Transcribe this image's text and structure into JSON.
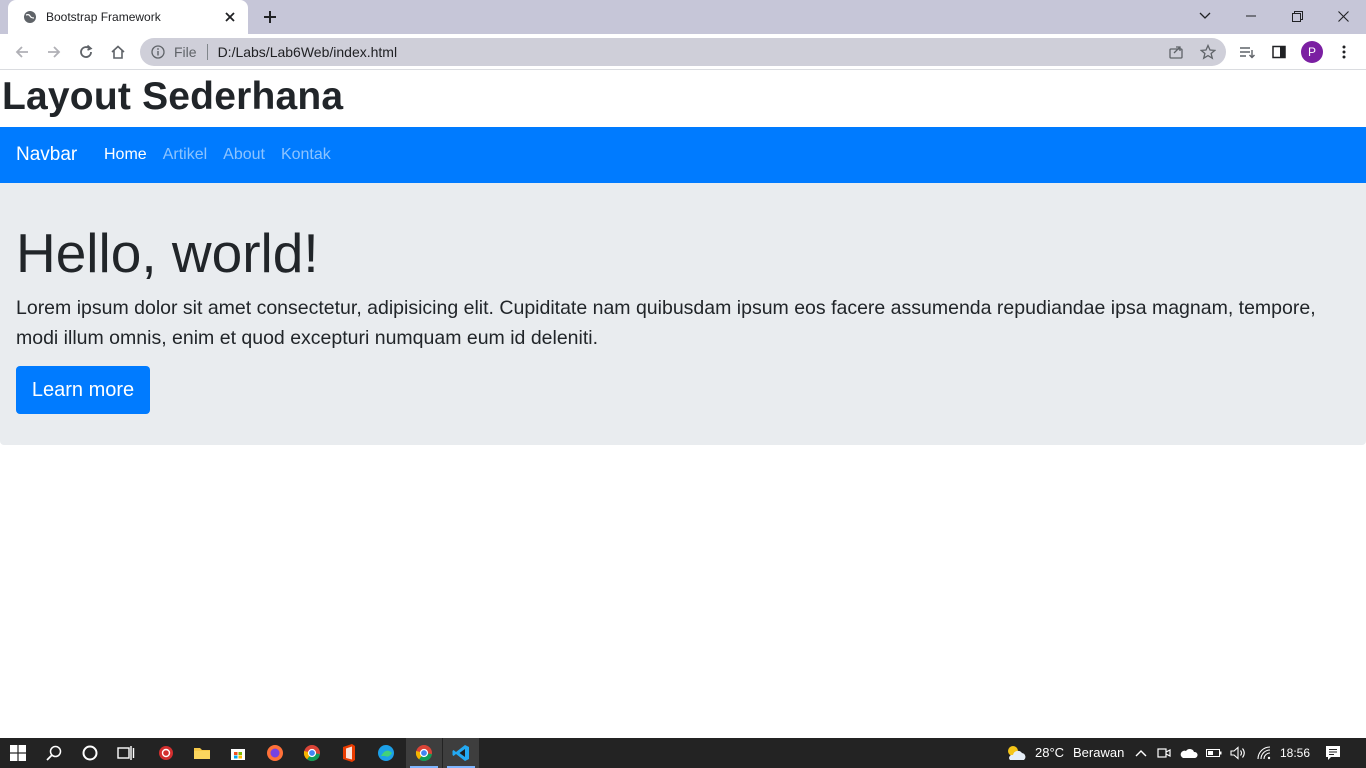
{
  "browser": {
    "tab_title": "Bootstrap Framework",
    "omnibox_scheme": "File",
    "omnibox_url": "D:/Labs/Lab6Web/index.html",
    "profile_initial": "P"
  },
  "page": {
    "heading": "Layout Sederhana",
    "navbar": {
      "brand": "Navbar",
      "links": [
        "Home",
        "Artikel",
        "About",
        "Kontak"
      ],
      "active": "Home"
    },
    "jumbotron": {
      "title": "Hello, world!",
      "lead": "Lorem ipsum dolor sit amet consectetur, adipisicing elit. Cupiditate nam quibusdam ipsum eos facere assumenda repudiandae ipsa magnam, tempore, modi illum omnis, enim et quod excepturi numquam eum id deleniti.",
      "button": "Learn more"
    }
  },
  "taskbar": {
    "weather_temp": "28°C",
    "weather_desc": "Berawan",
    "time": "18:56"
  },
  "colors": {
    "primary": "#007bff",
    "jumbotron_bg": "#e9ecef",
    "tabstrip_bg": "#c6c6d8",
    "avatar": "#7b1fa2"
  }
}
